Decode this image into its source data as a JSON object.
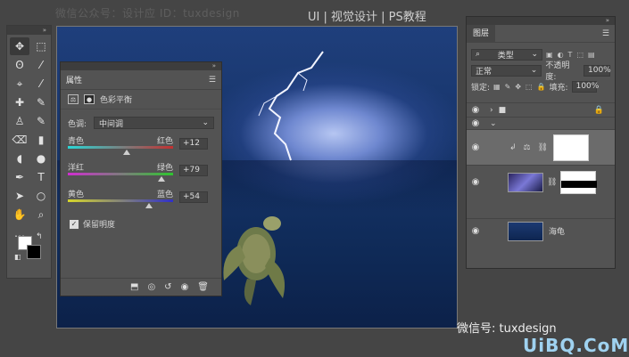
{
  "watermark_top": "微信公众号：设计应 ID：tuxdesign",
  "top_banner": "UI | 视觉设计 | PS教程",
  "tools": [
    "✥",
    "⬚",
    "ʘ",
    "⁄",
    "⌖",
    "⁄",
    "✚",
    "✎",
    "♙",
    "✎",
    "⌫",
    "▮",
    "◖",
    "●",
    "✒",
    "T",
    "➤",
    "○",
    "✋",
    "⌕"
  ],
  "properties": {
    "tab": "属性",
    "adjustment_name": "色彩平衡",
    "tone_label": "色调:",
    "tone_value": "中间调",
    "sliders": [
      {
        "left": "青色",
        "right": "红色",
        "value": "+12",
        "pos": 0.56,
        "colors": [
          "#2ad6d6",
          "#c23030"
        ]
      },
      {
        "left": "洋红",
        "right": "绿色",
        "value": "+79",
        "pos": 0.89,
        "colors": [
          "#d02ed0",
          "#2ec62e"
        ]
      },
      {
        "left": "黄色",
        "right": "蓝色",
        "value": "+54",
        "pos": 0.77,
        "colors": [
          "#d6d62a",
          "#3030c8"
        ]
      }
    ],
    "preserve_label": "保留明度"
  },
  "layers": {
    "tab": "图层",
    "filter_label": "类型",
    "blend_mode": "正常",
    "opacity_label": "不透明度:",
    "opacity_value": "100%",
    "lock_label": "锁定:",
    "fill_label": "填充:",
    "fill_value": "100%",
    "turtle_layer_name": "海龟"
  },
  "watermark_bottom": "微信号: tuxdesign",
  "logo_text": "UiBQ.CoM"
}
